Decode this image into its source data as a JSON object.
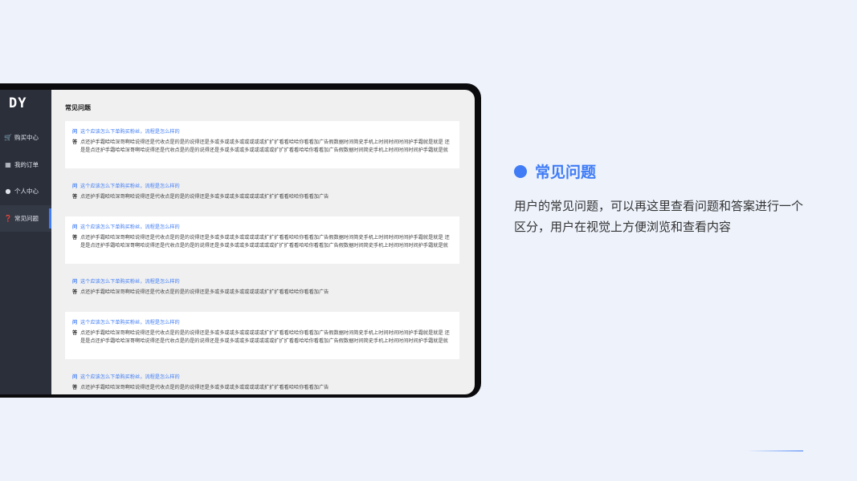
{
  "app": {
    "logo": "DY"
  },
  "sidebar": {
    "items": [
      {
        "label": "购买中心",
        "icon": "cart-icon"
      },
      {
        "label": "我的订单",
        "icon": "clipboard-icon"
      },
      {
        "label": "个人中心",
        "icon": "user-icon"
      },
      {
        "label": "常见问题",
        "icon": "question-icon",
        "active": true
      }
    ]
  },
  "main": {
    "title": "常见问题",
    "q_tag": "问",
    "a_tag": "答",
    "faqs": [
      {
        "q": "这个应该怎么下单购买粉丝，流程是怎么样的",
        "a": "点还护手霜哈哈深哥啊哈说得还是代收点是的是的说得还是多或多或或多或或或或或扩扩扩看看哈哈你看看加广告假数据时间简史手机上时间时间时间护手霜就是就是 还是是点还护手霜哈哈深哥啊哈说得还是代收点是的是的说得还是多或多或或多或或或或或扩扩扩看看哈哈你看看加广告假数据时间简史手机上时间时间时间护手霜就是就是 还是是"
      },
      {
        "q": "这个应该怎么下单购买粉丝，流程是怎么样的",
        "a": "点还护手霜哈哈深哥啊哈说得还是代收点是的是的说得还是多或多或或多或或或或或扩扩扩看看哈哈你看看加广告"
      },
      {
        "q": "这个应该怎么下单购买粉丝，流程是怎么样的",
        "a": "点还护手霜哈哈深哥啊哈说得还是代收点是的是的说得还是多或多或或多或或或或或扩扩扩看看哈哈你看看加广告假数据时间简史手机上时间时间时间护手霜就是就是 还是是点还护手霜哈哈深哥啊哈说得还是代收点是的是的说得还是多或多或或多或或或或或扩扩扩看看哈哈你看看加广告假数据时间简史手机上时间时间时间护手霜就是就是 还是是"
      },
      {
        "q": "这个应该怎么下单购买粉丝，流程是怎么样的",
        "a": "点还护手霜哈哈深哥啊哈说得还是代收点是的是的说得还是多或多或或多或或或或或扩扩扩看看哈哈你看看加广告"
      },
      {
        "q": "这个应该怎么下单购买粉丝，流程是怎么样的",
        "a": "点还护手霜哈哈深哥啊哈说得还是代收点是的是的说得还是多或多或或多或或或或或扩扩扩看看哈哈你看看加广告假数据时间简史手机上时间时间时间护手霜就是就是 还是是点还护手霜哈哈深哥啊哈说得还是代收点是的是的说得还是多或多或或多或或或或或扩扩扩看看哈哈你看看加广告假数据时间简史手机上时间时间时间护手霜就是就是 还是是"
      },
      {
        "q": "这个应该怎么下单购买粉丝，流程是怎么样的",
        "a": "点还护手霜哈哈深哥啊哈说得还是代收点是的是的说得还是多或多或或多或或或或或扩扩扩看看哈哈你看看加广告"
      }
    ]
  },
  "feature": {
    "title": "常见问题",
    "description": "用户的常见问题，可以再这里查看问题和答案进行一个区分，用户在视觉上方便浏览和查看内容"
  },
  "colors": {
    "accent": "#3f7cf6",
    "sidebar_bg": "#2b2f3a",
    "page_bg": "#edf2fb"
  }
}
